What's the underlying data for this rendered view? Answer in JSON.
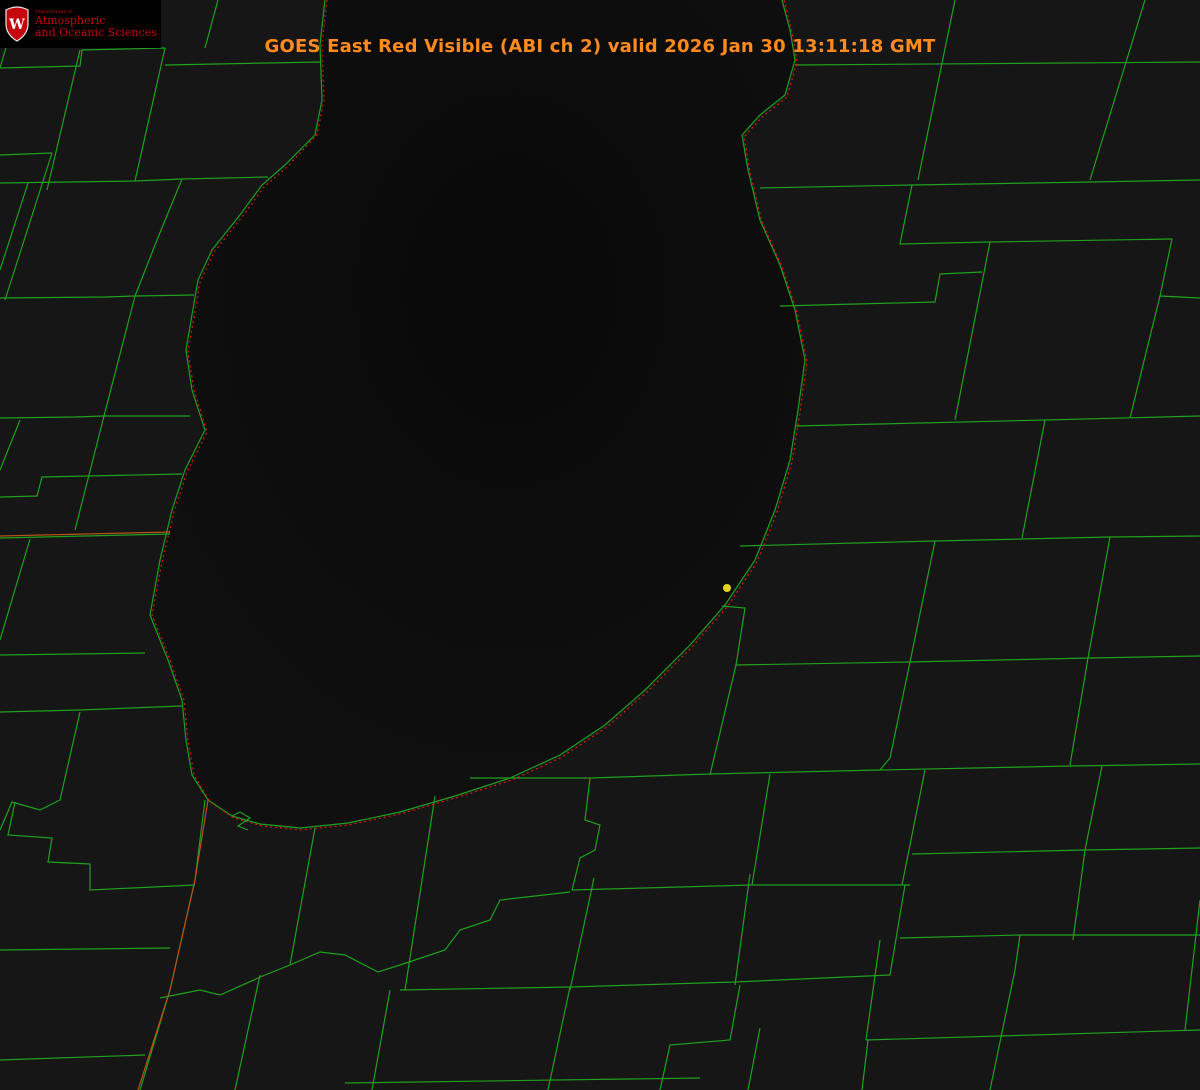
{
  "title": "GOES East Red Visible (ABI ch 2) valid 2026 Jan 30 13:11:18 GMT",
  "logo": {
    "crest_letter": "W",
    "department": "Department of",
    "line1": "Atmospheric",
    "line2": "and Oceanic Sciences"
  },
  "colors": {
    "background": "#141414",
    "lake": "#0b0b0b",
    "county_lines": "#1fa01f",
    "shoreline_dots": "#d81a1a",
    "state_line": "#b5521a",
    "title": "#ff8a1f",
    "logo_red": "#c5050c",
    "marker": "#e3d21a"
  },
  "map": {
    "feature": "lake",
    "marker_icon": "location-dot-icon"
  }
}
